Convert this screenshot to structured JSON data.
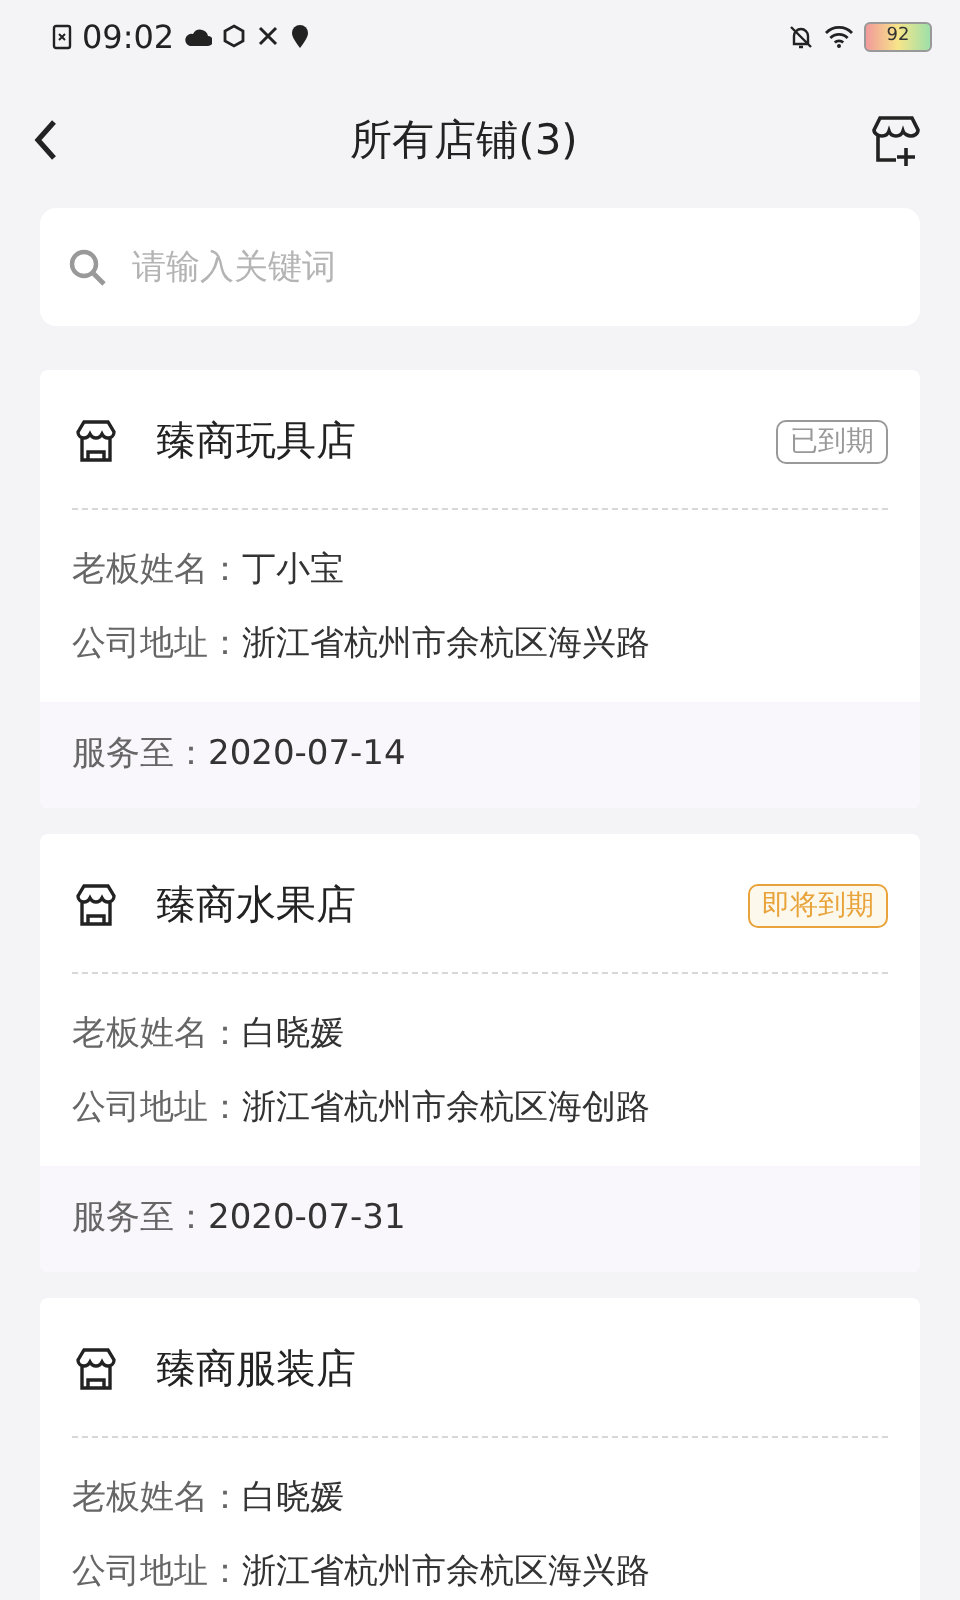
{
  "status_bar": {
    "time": "09:02",
    "battery": "92"
  },
  "header": {
    "title": "所有店铺(3)"
  },
  "search": {
    "placeholder": "请输入关键词"
  },
  "stores": [
    {
      "name": "臻商玩具店",
      "badge": {
        "kind": "expired",
        "text": "已到期"
      },
      "owner_label": "老板姓名：",
      "owner": "丁小宝",
      "address_label": "公司地址：",
      "address": "浙江省杭州市余杭区海兴路",
      "service_label": "服务至：",
      "service_date": "2020-07-14"
    },
    {
      "name": "臻商水果店",
      "badge": {
        "kind": "expiring",
        "text": "即将到期"
      },
      "owner_label": "老板姓名：",
      "owner": "白晓媛",
      "address_label": "公司地址：",
      "address": "浙江省杭州市余杭区海创路",
      "service_label": "服务至：",
      "service_date": "2020-07-31"
    },
    {
      "name": "臻商服装店",
      "owner_label": "老板姓名：",
      "owner": "白晓媛",
      "address_label": "公司地址：",
      "address": "浙江省杭州市余杭区海兴路"
    }
  ]
}
